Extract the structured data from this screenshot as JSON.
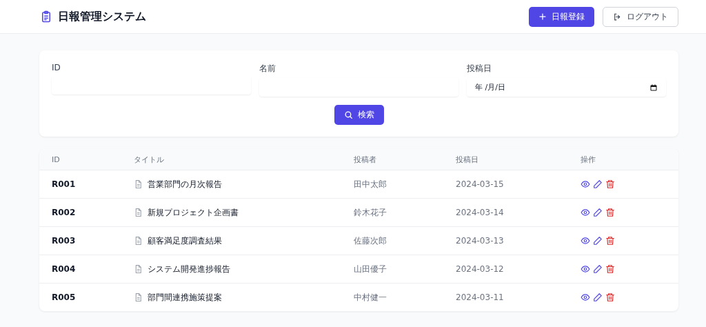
{
  "header": {
    "title": "日報管理システム",
    "buttons": [
      {
        "label": "日報登録",
        "kind": "primary"
      },
      {
        "label": "ログアウト",
        "kind": "outline"
      }
    ]
  },
  "search": {
    "fields": [
      {
        "label": "ID",
        "kind": "text"
      },
      {
        "label": "名前",
        "kind": "text"
      },
      {
        "label": "投稿日",
        "kind": "date",
        "placeholder": "年 /月/日"
      }
    ],
    "button": "検索"
  },
  "table": {
    "columns": [
      "ID",
      "タイトル",
      "投稿者",
      "投稿日",
      "操作"
    ],
    "rows": [
      {
        "id": "R001",
        "title": "営業部門の月次報告",
        "author": "田中太郎",
        "date": "2024-03-15"
      },
      {
        "id": "R002",
        "title": "新規プロジェクト企画書",
        "author": "鈴木花子",
        "date": "2024-03-14"
      },
      {
        "id": "R003",
        "title": "顧客満足度調査結果",
        "author": "佐藤次郎",
        "date": "2024-03-13"
      },
      {
        "id": "R004",
        "title": "システム開発進捗報告",
        "author": "山田優子",
        "date": "2024-03-12"
      },
      {
        "id": "R005",
        "title": "部門間連携施策提案",
        "author": "中村健一",
        "date": "2024-03-11"
      }
    ]
  }
}
